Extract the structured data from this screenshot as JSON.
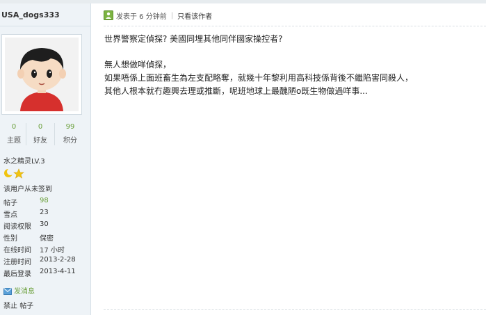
{
  "user": {
    "name": "USA_dogs333",
    "stats": [
      {
        "value": "0",
        "label": "主题"
      },
      {
        "value": "0",
        "label": "好友"
      },
      {
        "value": "99",
        "label": "积分"
      }
    ],
    "level": "水之精灵LV.3",
    "level_icons": [
      "moon-icon",
      "star-icon"
    ],
    "checkin": "该用户从未签到",
    "info": [
      {
        "key": "帖子",
        "value": "98"
      },
      {
        "key": "雪点",
        "value": "23"
      },
      {
        "key": "阅读权限",
        "value": "30"
      },
      {
        "key": "性别",
        "value": "保密"
      },
      {
        "key": "在线时间",
        "value": "17 小时"
      },
      {
        "key": "注册时间",
        "value": "2013-2-28"
      },
      {
        "key": "最后登录",
        "value": "2013-4-11"
      }
    ],
    "send_message": "发消息",
    "ban_label": "禁止",
    "posts_label": "帖子"
  },
  "post": {
    "posted": "发表于 6 分钟前",
    "only_author": "只看该作者",
    "lines": [
      "世界警察定偵探? 美國同埋其他同伴國家操控者?",
      "",
      "無人想做咩偵探，",
      "如果唔係上面班畜生為左支配略奪，就幾十年黎利用高科技係背後不繼陷害同殺人，",
      "其他人根本就冇趣興去理或推斷，呢班地球上最醜陋o既生物做過咩事..."
    ]
  },
  "colors": {
    "accent_green": "#6a9f3a",
    "sidebar_bg": "#eef3f7",
    "border": "#d7e1e8"
  }
}
